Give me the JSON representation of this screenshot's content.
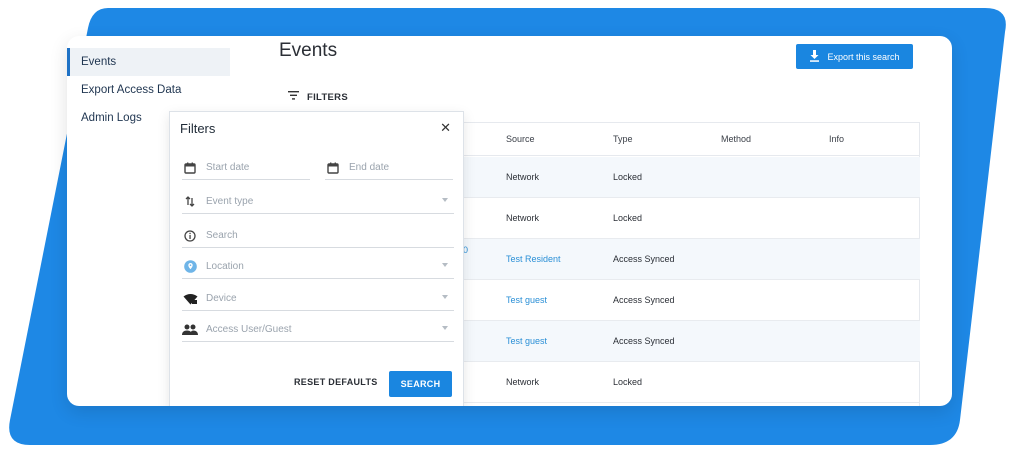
{
  "colors": {
    "accent": "#1a86e0",
    "link": "#2a8fd6",
    "background_shape": "#1e88e5"
  },
  "sidebar": {
    "items": [
      {
        "label": "Events",
        "active": true
      },
      {
        "label": "Export Access Data",
        "active": false
      },
      {
        "label": "Admin Logs",
        "active": false
      }
    ]
  },
  "header": {
    "title": "Events",
    "export_label": "Export this search",
    "export_icon": "download-icon"
  },
  "filters_toggle": {
    "label": "FILTERS",
    "icon": "filter-list-icon"
  },
  "table": {
    "columns": [
      "Source",
      "Type",
      "Method",
      "Info"
    ],
    "rows": [
      {
        "source": "Network",
        "type": "Locked",
        "source_link": false
      },
      {
        "source": "Network",
        "type": "Locked",
        "source_link": false
      },
      {
        "source": "Test Resident",
        "type": "Access Synced",
        "source_link": true
      },
      {
        "source": "Test guest",
        "type": "Access Synced",
        "source_link": true
      },
      {
        "source": "Test guest",
        "type": "Access Synced",
        "source_link": true
      },
      {
        "source": "Network",
        "type": "Locked",
        "source_link": false
      }
    ],
    "peek_text": "0"
  },
  "filters_panel": {
    "title": "Filters",
    "start_date_placeholder": "Start date",
    "end_date_placeholder": "End date",
    "event_type_placeholder": "Event type",
    "search_placeholder": "Search",
    "location_placeholder": "Location",
    "device_placeholder": "Device",
    "access_user_placeholder": "Access User/Guest",
    "reset_label": "RESET DEFAULTS",
    "search_label": "SEARCH"
  }
}
